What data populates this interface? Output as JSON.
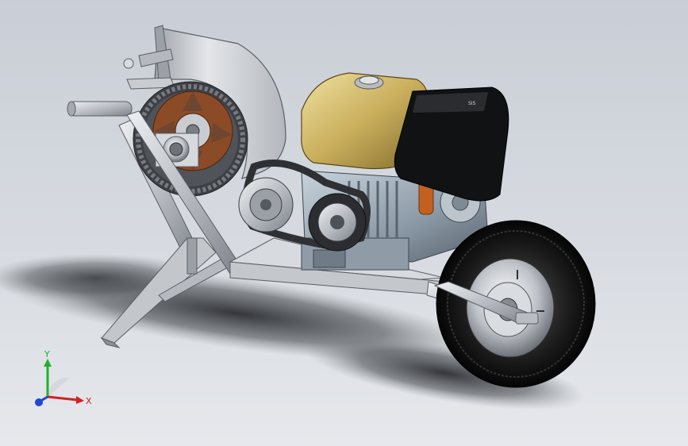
{
  "viewport": {
    "background_top": "#c9ced6",
    "background_bottom": "#e6e8ec"
  },
  "triad": {
    "x_label": "X",
    "y_label": "Y",
    "x_color": "#d42020",
    "y_color": "#22b02a",
    "z_color": "#2246d4"
  },
  "model": {
    "engine_label": "SIS"
  }
}
